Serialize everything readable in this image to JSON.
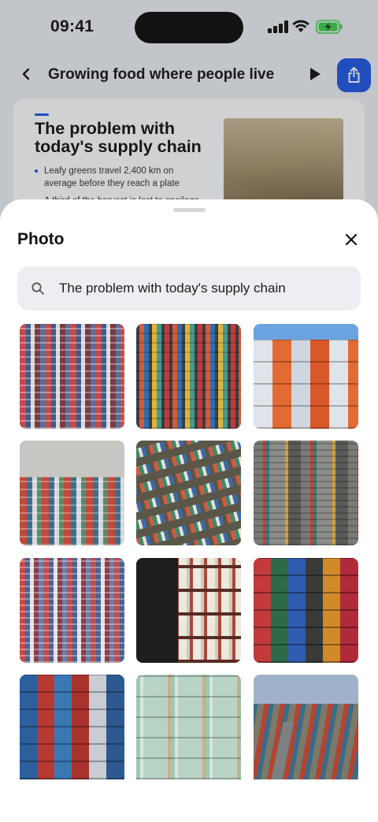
{
  "status_bar": {
    "time": "09:41"
  },
  "nav": {
    "title": "Growing food where people live"
  },
  "slide": {
    "title": "The problem with today's supply chain",
    "bullets": [
      "Leafy greens travel 2,400 km on average before they reach a plate",
      "A third of the harvest is lost to spoilage"
    ]
  },
  "sheet": {
    "title": "Photo",
    "search": {
      "value": "The problem with today's supply chain"
    },
    "photos": [
      {
        "id": "photo-1"
      },
      {
        "id": "photo-2"
      },
      {
        "id": "photo-3"
      },
      {
        "id": "photo-4"
      },
      {
        "id": "photo-5"
      },
      {
        "id": "photo-6"
      },
      {
        "id": "photo-7"
      },
      {
        "id": "photo-8"
      },
      {
        "id": "photo-9"
      },
      {
        "id": "photo-10"
      },
      {
        "id": "photo-11"
      },
      {
        "id": "photo-12"
      }
    ]
  },
  "colors": {
    "accent": "#1f57e6",
    "search_bg": "#eceef2",
    "battery_green": "#3ecf4c"
  },
  "icons": [
    "back-chevron-icon",
    "play-icon",
    "share-icon",
    "close-icon",
    "search-icon",
    "wifi-icon",
    "signal-icon",
    "battery-charging-icon"
  ]
}
